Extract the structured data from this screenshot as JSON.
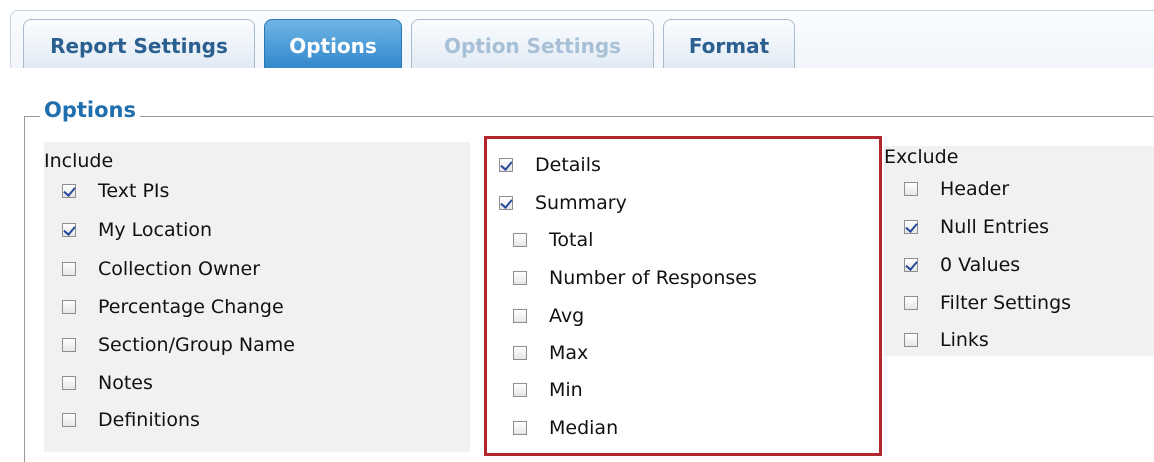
{
  "tabs": [
    {
      "label": "Report Settings",
      "state": "normal"
    },
    {
      "label": "Options",
      "state": "active"
    },
    {
      "label": "Option Settings",
      "state": "disabled"
    },
    {
      "label": "Format",
      "state": "normal"
    }
  ],
  "options_group": {
    "legend": "Options",
    "include": {
      "label": "Include",
      "items": [
        {
          "label": "Text PIs",
          "checked": true
        },
        {
          "label": "My Location",
          "checked": true
        },
        {
          "label": "Collection Owner",
          "checked": false
        },
        {
          "label": "Percentage Change",
          "checked": false
        },
        {
          "label": "Section/Group Name",
          "checked": false
        },
        {
          "label": "Notes",
          "checked": false
        },
        {
          "label": "Definitions",
          "checked": false
        }
      ]
    },
    "middle": {
      "items": [
        {
          "label": "Details",
          "checked": true
        },
        {
          "label": "Summary",
          "checked": true
        },
        {
          "label": "Total",
          "checked": false
        },
        {
          "label": "Number of Responses",
          "checked": false
        },
        {
          "label": "Avg",
          "checked": false
        },
        {
          "label": "Max",
          "checked": false
        },
        {
          "label": "Min",
          "checked": false
        },
        {
          "label": "Median",
          "checked": false
        }
      ]
    },
    "exclude": {
      "label": "Exclude",
      "items": [
        {
          "label": "Header",
          "checked": false
        },
        {
          "label": "Null Entries",
          "checked": true
        },
        {
          "label": "0 Values",
          "checked": true
        },
        {
          "label": "Filter Settings",
          "checked": false
        },
        {
          "label": "Links",
          "checked": false
        }
      ]
    }
  },
  "colors": {
    "active_tab": "#2e86c9",
    "legend": "#1f6fae",
    "highlight_border": "#b2262b",
    "check": "#2a4a9e"
  }
}
